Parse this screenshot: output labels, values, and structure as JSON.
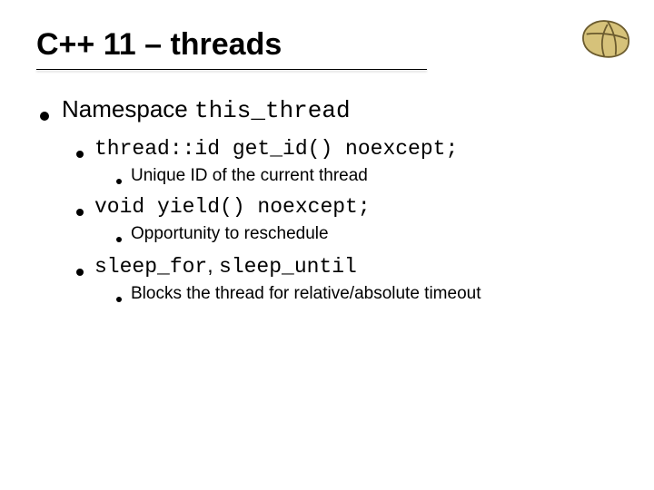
{
  "title": "C++ 11 – threads",
  "lvl1": {
    "prefix": "Namespace ",
    "code": "this_thread"
  },
  "items": [
    {
      "code": "thread::id get_id() noexcept;",
      "sub": "Unique ID of the current thread"
    },
    {
      "code": "void yield() noexcept;",
      "sub": "Opportunity to reschedule"
    },
    {
      "code_a": "sleep_for",
      "mid": ", ",
      "code_b": "sleep_until",
      "sub": "Blocks the thread for relative/absolute timeout"
    }
  ]
}
